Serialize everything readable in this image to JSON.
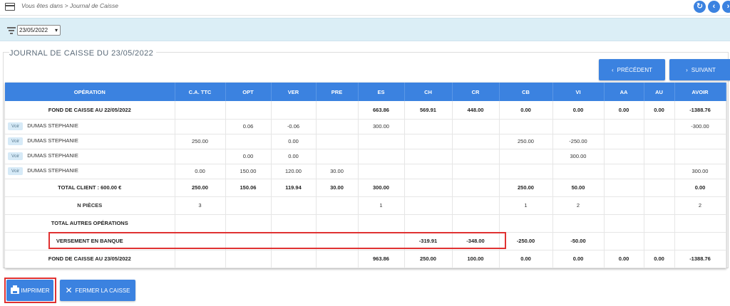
{
  "breadcrumb": "Vous êtes dans > Journal de Caisse",
  "nav_icons": [
    "refresh-icon",
    "back-icon",
    "forward-icon"
  ],
  "filter": {
    "date_value": "23/05/2022"
  },
  "journal": {
    "title": "JOURNAL DE CAISSE DU 23/05/2022",
    "prev_label": "PRÉCÉDENT",
    "next_label": "SUIVANT",
    "headers": [
      "OPÉRATION",
      "C.A. TTC",
      "OPT",
      "VER",
      "PRE",
      "ES",
      "CH",
      "CR",
      "CB",
      "VI",
      "AA",
      "AU",
      "AVOIR"
    ],
    "voir_label": "Voir",
    "rows": [
      {
        "type": "bold",
        "cells": [
          "FOND DE CAISSE AU 22/05/2022",
          "",
          "",
          "",
          "",
          "663.86",
          "569.91",
          "448.00",
          "0.00",
          "0.00",
          "0.00",
          "0.00",
          "-1388.76"
        ]
      },
      {
        "type": "client",
        "cells": [
          "DUMAS STEPHANIE",
          "",
          "0.06",
          "-0.06",
          "",
          "300.00",
          "",
          "",
          "",
          "",
          "",
          "",
          "-300.00"
        ]
      },
      {
        "type": "client",
        "cells": [
          "DUMAS STEPHANIE",
          "250.00",
          "",
          "0.00",
          "",
          "",
          "",
          "",
          "250.00",
          "-250.00",
          "",
          "",
          ""
        ]
      },
      {
        "type": "client",
        "cells": [
          "DUMAS STEPHANIE",
          "",
          "0.00",
          "0.00",
          "",
          "",
          "",
          "",
          "",
          "300.00",
          "",
          "",
          ""
        ]
      },
      {
        "type": "client",
        "cells": [
          "DUMAS STEPHANIE",
          "0.00",
          "150.00",
          "120.00",
          "30.00",
          "",
          "",
          "",
          "",
          "",
          "",
          "",
          "300.00"
        ]
      },
      {
        "type": "bold",
        "cells": [
          "TOTAL CLIENT : 600.00 €",
          "250.00",
          "150.06",
          "119.94",
          "30.00",
          "300.00",
          "",
          "",
          "250.00",
          "50.00",
          "",
          "",
          "0.00"
        ]
      },
      {
        "type": "normal-label",
        "cells": [
          "N PIÈCES",
          "3",
          "",
          "",
          "",
          "1",
          "",
          "",
          "1",
          "2",
          "",
          "",
          "2"
        ]
      },
      {
        "type": "label",
        "cells": [
          "TOTAL AUTRES OPÉRATIONS",
          "",
          "",
          "",
          "",
          "",
          "",
          "",
          "",
          "",
          "",
          "",
          ""
        ]
      },
      {
        "type": "bold",
        "cells": [
          "VERSEMENT EN BANQUE",
          "",
          "",
          "",
          "",
          "",
          "-319.91",
          "-348.00",
          "-250.00",
          "-50.00",
          "",
          "",
          ""
        ]
      },
      {
        "type": "bold",
        "cells": [
          "FOND DE CAISSE AU 23/05/2022",
          "",
          "",
          "",
          "",
          "963.86",
          "250.00",
          "100.00",
          "0.00",
          "0.00",
          "0.00",
          "0.00",
          "-1388.76"
        ]
      }
    ]
  },
  "actions": {
    "print_label": "IMPRIMER",
    "close_label": "FERMER LA CAISSE"
  },
  "colors": {
    "accent": "#3b82e0",
    "highlight": "#e03131",
    "filter_bg": "#dbeef6"
  }
}
